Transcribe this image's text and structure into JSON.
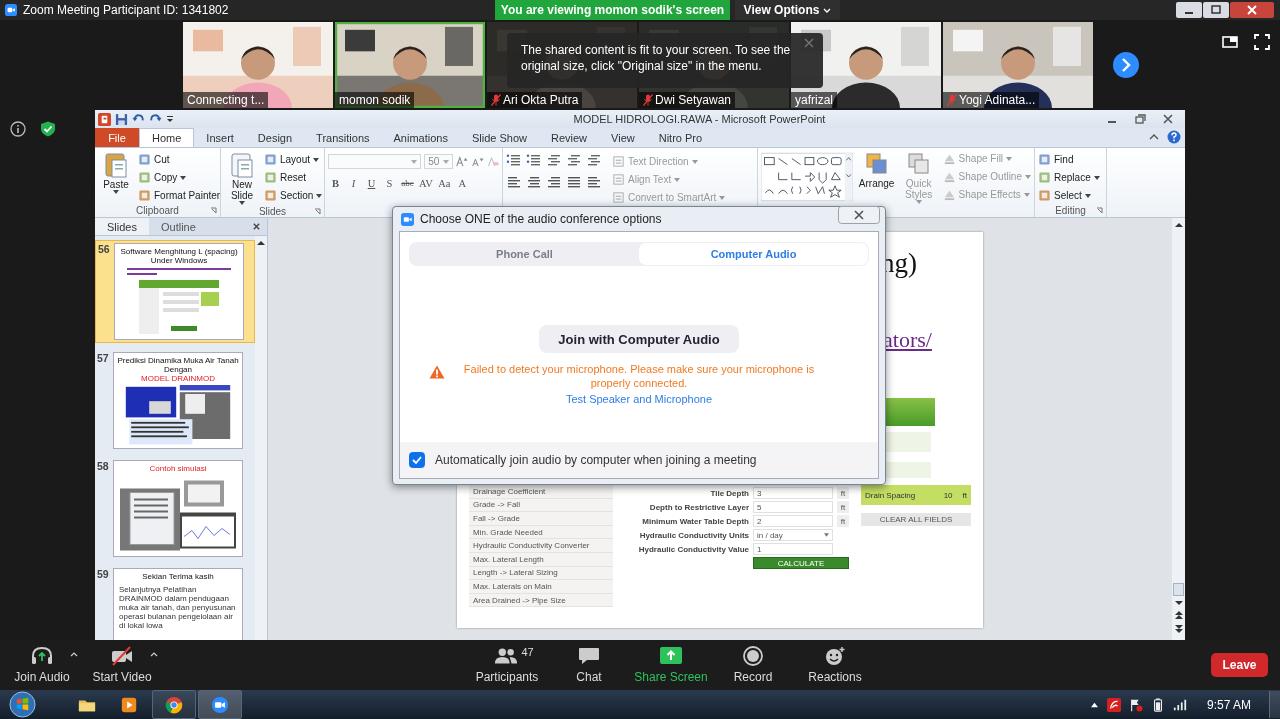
{
  "window": {
    "title": "Zoom Meeting Participant ID: 1341802"
  },
  "share_banner": {
    "text": "You are viewing momon sodik's screen",
    "menu": "View Options"
  },
  "participants": [
    {
      "name": "Connecting t...",
      "muted": false,
      "speaking": false
    },
    {
      "name": "momon sodik",
      "muted": false,
      "speaking": true
    },
    {
      "name": "Ari Okta Putra",
      "muted": true,
      "speaking": false
    },
    {
      "name": "Dwi Setyawan",
      "muted": true,
      "speaking": false
    },
    {
      "name": "yafrizal",
      "muted": false,
      "speaking": false
    },
    {
      "name": "Yogi Adinata...",
      "muted": true,
      "speaking": false
    }
  ],
  "tooltip": {
    "text": "The shared content is fit to your screen. To see the original size, click \"Original size\" in the menu."
  },
  "powerpoint": {
    "title": "MODEL HIDROLOGI.RAWA - Microsoft PowerPoint",
    "tabs": [
      {
        "label": "File",
        "kind": "file",
        "selected": false
      },
      {
        "label": "Home",
        "kind": "tab",
        "selected": true
      },
      {
        "label": "Insert",
        "kind": "tab",
        "selected": false
      },
      {
        "label": "Design",
        "kind": "tab",
        "selected": false
      },
      {
        "label": "Transitions",
        "kind": "tab",
        "selected": false
      },
      {
        "label": "Animations",
        "kind": "tab",
        "selected": false
      },
      {
        "label": "Slide Show",
        "kind": "tab",
        "selected": false
      },
      {
        "label": "Review",
        "kind": "tab",
        "selected": false
      },
      {
        "label": "View",
        "kind": "tab",
        "selected": false
      },
      {
        "label": "Nitro Pro",
        "kind": "tab",
        "selected": false
      }
    ],
    "ribbon": [
      {
        "kind": "buttons",
        "label": "Clipboard",
        "large": {
          "label": "Paste",
          "dropdown": true,
          "disabled": false
        },
        "small": [
          {
            "label": "Cut",
            "dropdown": false,
            "disabled": false
          },
          {
            "label": "Copy",
            "dropdown": true,
            "disabled": false
          },
          {
            "label": "Format Painter",
            "dropdown": false,
            "disabled": false
          }
        ]
      },
      {
        "kind": "buttons",
        "label": "Slides",
        "large": {
          "label": "New Slide",
          "dropdown": true,
          "disabled": false
        },
        "small": [
          {
            "label": "Layout",
            "dropdown": true,
            "disabled": false
          },
          {
            "label": "Reset",
            "dropdown": false,
            "disabled": false
          },
          {
            "label": "Section",
            "dropdown": true,
            "disabled": false
          }
        ]
      },
      {
        "kind": "font",
        "size": "50",
        "buttons": [
          "B",
          "I",
          "U",
          "S",
          "abc",
          "AV",
          "Aa",
          "A"
        ]
      },
      {
        "kind": "paragraph",
        "small": [
          {
            "label": "Text Direction",
            "dropdown": true,
            "disabled": true
          },
          {
            "label": "Align Text",
            "dropdown": true,
            "disabled": true
          },
          {
            "label": "Convert to SmartArt",
            "dropdown": true,
            "disabled": true
          }
        ]
      },
      {
        "kind": "drawing",
        "large": [
          {
            "label": "Arrange",
            "dropdown": false,
            "disabled": false
          },
          {
            "label": "Quick Styles",
            "dropdown": true,
            "disabled": true
          }
        ],
        "small": [
          {
            "label": "Shape Fill",
            "dropdown": true,
            "disabled": true
          },
          {
            "label": "Shape Outline",
            "dropdown": true,
            "disabled": true
          },
          {
            "label": "Shape Effects",
            "dropdown": true,
            "disabled": true
          }
        ]
      },
      {
        "kind": "buttons",
        "label": "Editing",
        "small": [
          {
            "label": "Find",
            "dropdown": false,
            "disabled": false
          },
          {
            "label": "Replace",
            "dropdown": true,
            "disabled": false
          },
          {
            "label": "Select",
            "dropdown": true,
            "disabled": false
          }
        ]
      }
    ],
    "panel_tabs": [
      {
        "label": "Slides",
        "selected": true
      },
      {
        "label": "Outline",
        "selected": false
      }
    ],
    "slides": [
      {
        "number": "56",
        "selected": true,
        "kind": "web-form",
        "title": "Software Menghitung L (spacing) Under Windows",
        "highlighted": false
      },
      {
        "number": "57",
        "selected": false,
        "kind": "screenshots",
        "title": "Prediksi  Dinamika Muka Air Tanah Dengan",
        "subtitle": "MODEL DRAINMOD",
        "highlighted": false
      },
      {
        "number": "58",
        "selected": false,
        "kind": "charts",
        "title": "Contoh simulasi",
        "highlighted": true
      },
      {
        "number": "59",
        "selected": false,
        "kind": "text",
        "title": "Sekian Terima kasih",
        "highlighted": false,
        "bullet": "Selanjutnya Pelatihan DRAINMOD dalam pendugaan muka air tanah, dan penyusunan operasi bulanan pengelolaan air di lokal lowa"
      }
    ],
    "slide": {
      "title_fragment": "ng)",
      "link_fragment": "ators/",
      "form": {
        "menu": [
          "Drainage Coefficient",
          "Grade -> Fall",
          "Fall -> Grade",
          "Min. Grade Needed",
          "Hydraulic Conductivity Converter",
          "Max. Lateral Length",
          "Length -> Lateral Sizing",
          "Max. Laterals on Main",
          "Area Drained -> Pipe Size"
        ],
        "fields": [
          {
            "label": "Tile Depth",
            "value": "3",
            "unit": "ft",
            "kind": "input"
          },
          {
            "label": "Depth to Restrictive Layer",
            "value": "5",
            "unit": "ft",
            "kind": "input"
          },
          {
            "label": "Minimum Water Table Depth",
            "value": "2",
            "unit": "ft",
            "kind": "input"
          },
          {
            "label": "Hydraulic Conductivity Units",
            "value": "in / day",
            "kind": "select"
          },
          {
            "label": "Hydraulic Conductivity Value",
            "value": "1",
            "kind": "input"
          }
        ],
        "calculate": "CALCULATE",
        "result": {
          "label": "Drain Spacing",
          "value": "10",
          "unit": "ft"
        },
        "clear": "CLEAR ALL FIELDS"
      }
    }
  },
  "dialog": {
    "title": "Choose ONE of the audio conference options",
    "tabs": [
      {
        "label": "Phone Call",
        "selected": false
      },
      {
        "label": "Computer Audio",
        "selected": true
      }
    ],
    "join_button": "Join with Computer Audio",
    "warning": "Failed to detect your microphone. Please make sure your microphone is properly connected.",
    "test_link": "Test Speaker and Microphone",
    "auto_join": {
      "label": "Automatically join audio by computer when joining a meeting",
      "checked": true
    }
  },
  "toolbar": {
    "join_audio": "Join Audio",
    "start_video": "Start Video",
    "participants": "Participants",
    "participant_count": "47",
    "chat": "Chat",
    "share_screen": "Share Screen",
    "record": "Record",
    "reactions": "Reactions",
    "leave": "Leave"
  },
  "taskbar": {
    "time": "9:57 AM"
  }
}
